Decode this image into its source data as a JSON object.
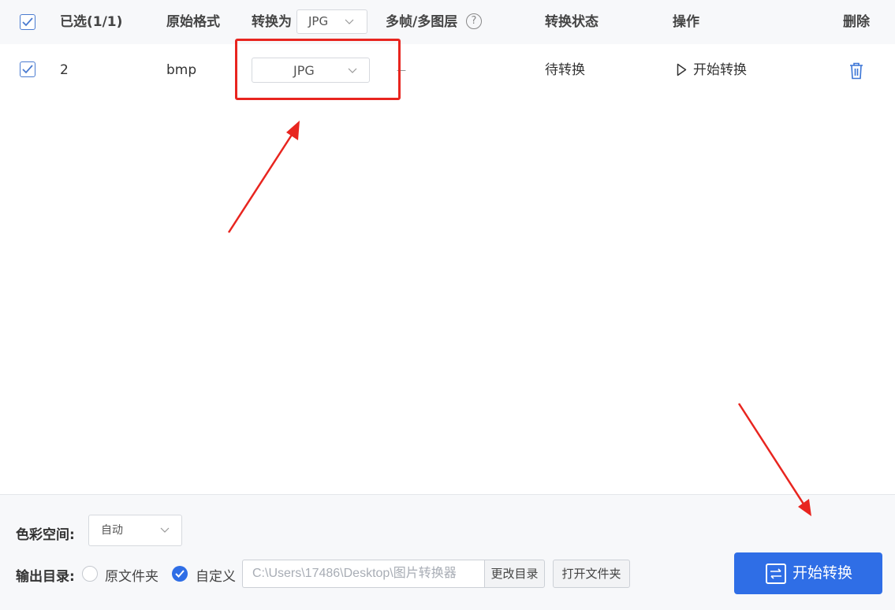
{
  "header": {
    "selected": "已选(1/1)",
    "original_format": "原始格式",
    "convert_to": "转换为",
    "convert_to_value": "JPG",
    "multi_frame": "多帧/多图层",
    "help_glyph": "?",
    "status": "转换状态",
    "action": "操作",
    "delete": "删除"
  },
  "rows": [
    {
      "name": "2",
      "format": "bmp",
      "target": "JPG",
      "multi_frame": "—",
      "status": "待转换",
      "action": "开始转换"
    }
  ],
  "bottom": {
    "color_space_label": "色彩空间:",
    "color_space_value": "自动",
    "output_label": "输出目录:",
    "option_original": "原文件夹",
    "option_custom": "自定义",
    "path": "C:\\Users\\17486\\Desktop\\图片转换器",
    "change_dir": "更改目录",
    "open_folder": "打开文件夹",
    "start": "开始转换"
  },
  "icons": {
    "checkbox": "checkbox-checked-icon",
    "chevron": "chevron-down-icon",
    "play": "play-icon",
    "trash": "trash-icon",
    "convert": "convert-icon"
  },
  "colors": {
    "accent": "#2f6ee6",
    "checkbox": "#4a7bd0",
    "annotation_red": "#e8251f",
    "header_bg": "#f7f8fa"
  }
}
